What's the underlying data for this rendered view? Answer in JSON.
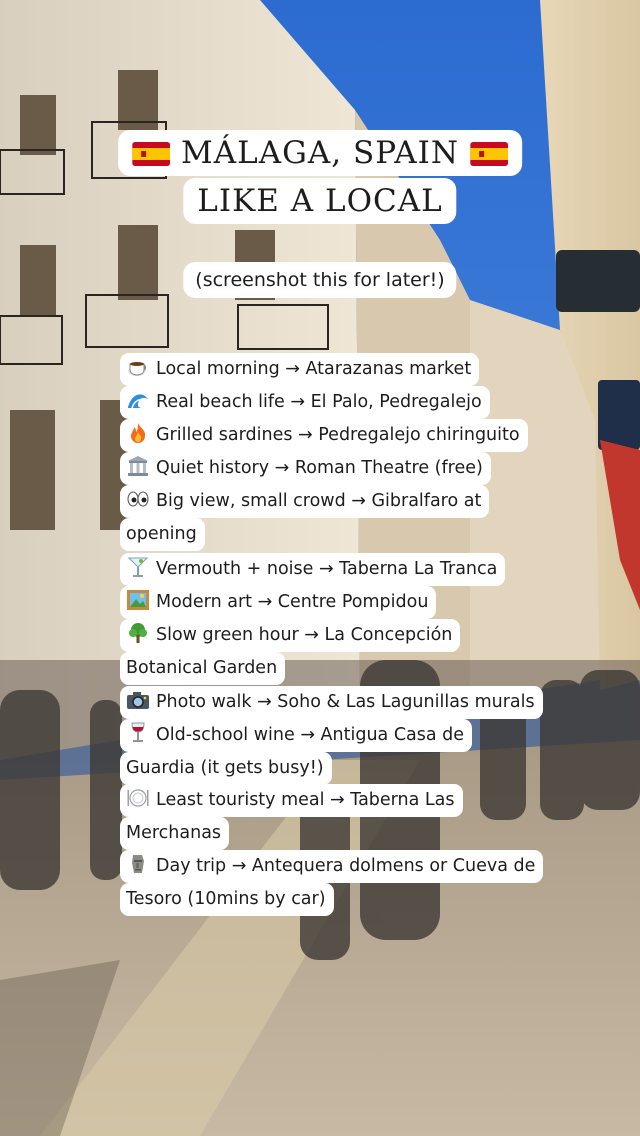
{
  "title": {
    "line1": "MÁLAGA, SPAIN",
    "line2": "LIKE A LOCAL",
    "flag_icon": "spain-flag-icon"
  },
  "subtitle": "(screenshot this for later!)",
  "items": [
    {
      "icon": "coffee-icon",
      "lines": [
        "Local morning → Atarazanas market"
      ]
    },
    {
      "icon": "wave-icon",
      "lines": [
        "Real beach life → El Palo, Pedregalejo"
      ]
    },
    {
      "icon": "fire-icon",
      "lines": [
        "Grilled sardines → Pedregalejo chiringuito"
      ]
    },
    {
      "icon": "classical-building-icon",
      "lines": [
        "Quiet history → Roman Theatre (free)"
      ]
    },
    {
      "icon": "eyes-icon",
      "lines": [
        "Big view, small crowd → Gibralfaro at",
        "opening"
      ]
    },
    {
      "icon": "cocktail-icon",
      "lines": [
        "Vermouth + noise → Taberna La Tranca"
      ]
    },
    {
      "icon": "framed-picture-icon",
      "lines": [
        "Modern art → Centre Pompidou"
      ]
    },
    {
      "icon": "tree-icon",
      "lines": [
        "Slow green hour → La Concepción",
        "Botanical Garden"
      ]
    },
    {
      "icon": "camera-icon",
      "lines": [
        "Photo walk → Soho & Las Lagunillas murals"
      ]
    },
    {
      "icon": "wine-glass-icon",
      "lines": [
        "Old-school wine → Antigua Casa de",
        "Guardia (it gets busy!)"
      ]
    },
    {
      "icon": "plate-cutlery-icon",
      "lines": [
        "Least touristy meal → Taberna Las",
        "Merchanas"
      ]
    },
    {
      "icon": "moai-icon",
      "lines": [
        "Day trip → Antequera dolmens or Cueva de",
        "Tesoro (10mins by car)"
      ]
    }
  ],
  "colors": {
    "sky": "#2f6fd1",
    "building_left": "#e6dccb",
    "building_right": "#e9dcc2",
    "street": "#b8a890",
    "flag_red": "#c60b1e",
    "flag_yellow": "#ffc400"
  }
}
